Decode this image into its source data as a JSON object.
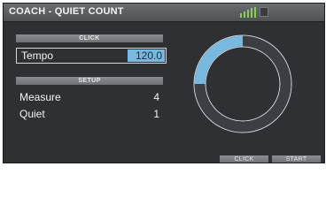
{
  "title": "COACH - QUIET COUNT",
  "click_section": {
    "header": "CLICK",
    "tempo_label": "Tempo",
    "tempo_value": "120.0"
  },
  "setup_section": {
    "header": "SETUP",
    "measure_label": "Measure",
    "measure_value": "4",
    "quiet_label": "Quiet",
    "quiet_value": "1"
  },
  "donut": {
    "highlight_fraction": 0.25,
    "highlight_color": "#78b9df",
    "track_color": "#3b3e42",
    "ring_stroke_color": "#d9dcde"
  },
  "function_buttons": {
    "f1": "CLICK",
    "f2": "START"
  },
  "colors": {
    "screen_bg": "#2e3033",
    "accent": "#78b9df"
  }
}
